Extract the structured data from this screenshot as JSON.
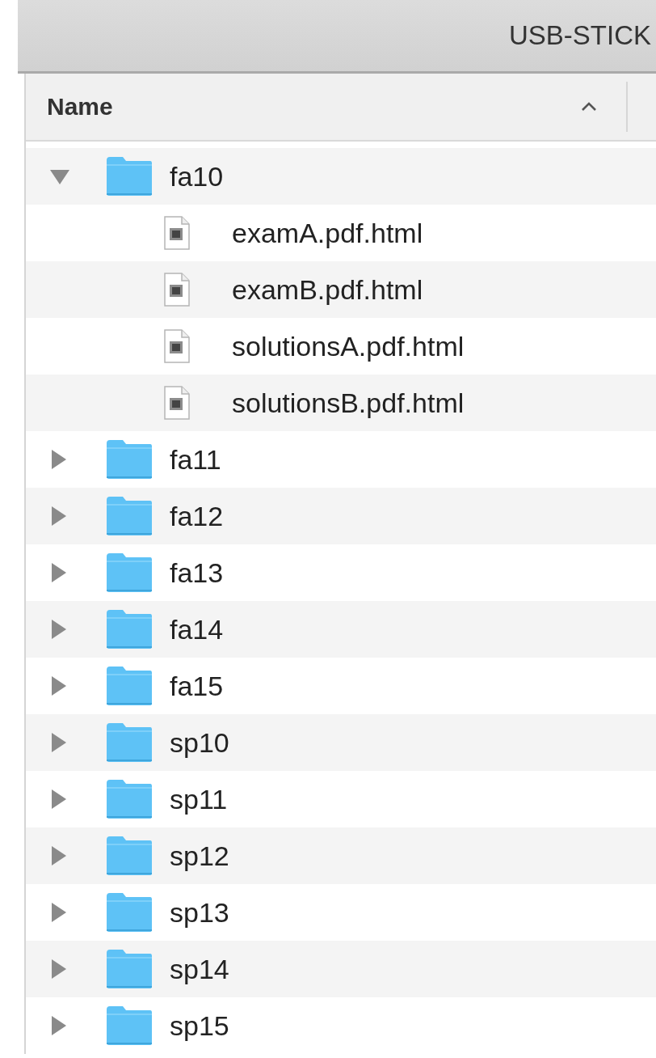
{
  "window": {
    "title": "USB-STICK"
  },
  "columns": [
    {
      "label": "Name",
      "sort_ascending": true
    }
  ],
  "items": [
    {
      "name": "fa10",
      "kind": "folder",
      "expanded": true,
      "children": [
        {
          "name": "examA.pdf.html",
          "kind": "file"
        },
        {
          "name": "examB.pdf.html",
          "kind": "file"
        },
        {
          "name": "solutionsA.pdf.html",
          "kind": "file"
        },
        {
          "name": "solutionsB.pdf.html",
          "kind": "file"
        }
      ]
    },
    {
      "name": "fa11",
      "kind": "folder",
      "expanded": false
    },
    {
      "name": "fa12",
      "kind": "folder",
      "expanded": false
    },
    {
      "name": "fa13",
      "kind": "folder",
      "expanded": false
    },
    {
      "name": "fa14",
      "kind": "folder",
      "expanded": false
    },
    {
      "name": "fa15",
      "kind": "folder",
      "expanded": false
    },
    {
      "name": "sp10",
      "kind": "folder",
      "expanded": false
    },
    {
      "name": "sp11",
      "kind": "folder",
      "expanded": false
    },
    {
      "name": "sp12",
      "kind": "folder",
      "expanded": false
    },
    {
      "name": "sp13",
      "kind": "folder",
      "expanded": false
    },
    {
      "name": "sp14",
      "kind": "folder",
      "expanded": false
    },
    {
      "name": "sp15",
      "kind": "folder",
      "expanded": false
    }
  ]
}
